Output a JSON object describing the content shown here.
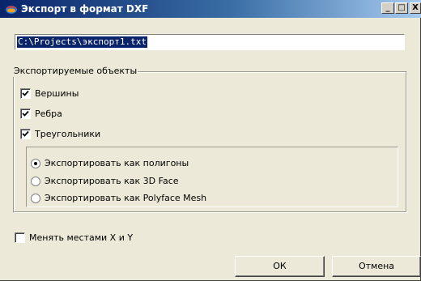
{
  "window": {
    "title": "Экспорт в формат DXF",
    "minimize_glyph": "_",
    "maximize_glyph": "□",
    "close_glyph": "X"
  },
  "path": {
    "value": "C:\\Projects\\экспорт1.txt"
  },
  "export_objects": {
    "title": "Экспортируемые объекты",
    "checkboxes": [
      {
        "label": "Вершины",
        "checked": true
      },
      {
        "label": "Ребра",
        "checked": true
      },
      {
        "label": "Треугольники",
        "checked": true
      }
    ],
    "radios": [
      {
        "label": "Экспортировать как полигоны",
        "selected": true
      },
      {
        "label": "Экспортировать как 3D Face",
        "selected": false
      },
      {
        "label": "Экспортировать как Polyface Mesh",
        "selected": false
      }
    ]
  },
  "swap_xy": {
    "label": "Менять местами X и Y",
    "checked": false
  },
  "buttons": {
    "ok": "ОК",
    "cancel": "Отмена"
  },
  "colors": {
    "titlebar_start": "#0a246a",
    "dialog_bg": "#ece9d8",
    "selection": "#0a246a"
  }
}
